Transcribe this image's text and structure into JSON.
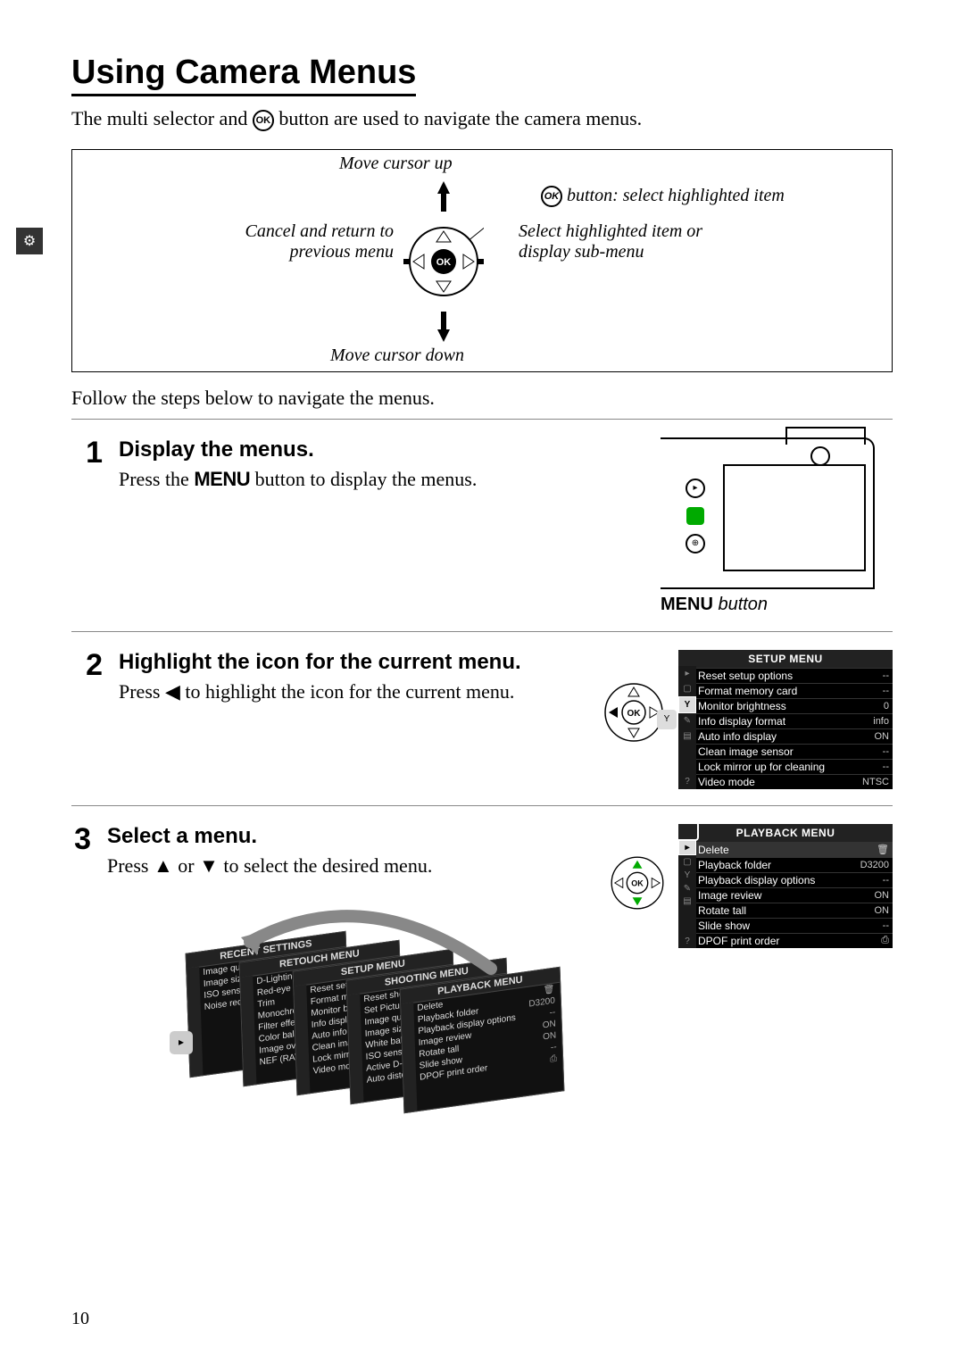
{
  "page_number": "10",
  "heading": "Using Camera Menus",
  "intro_pre": "The multi selector and ",
  "intro_post": " button are used to navigate the camera menus.",
  "ok_glyph": "OK",
  "selector": {
    "up": "Move cursor up",
    "down": "Move cursor down",
    "left": "Cancel and return to previous menu",
    "right": "Select highlighted item or display sub-menu",
    "ok": " button: select highlighted item"
  },
  "follow": "Follow the steps below to navigate the menus.",
  "steps": [
    {
      "num": "1",
      "title": "Display the menus.",
      "text_pre": "Press the ",
      "text_glyph": "MENU",
      "text_post": " button to display the menus.",
      "caption_glyph": "MENU",
      "caption_post": " button"
    },
    {
      "num": "2",
      "title": "Highlight the icon for the current menu.",
      "text_pre": "Press ",
      "text_glyph": "◀",
      "text_post": " to highlight the icon for the current menu."
    },
    {
      "num": "3",
      "title": "Select a menu.",
      "text_pre": "Press ",
      "text_glyph1": "▲",
      "text_mid": " or ",
      "text_glyph2": "▼",
      "text_post": " to select the desired menu."
    }
  ],
  "setup_menu": {
    "title": "SETUP MENU",
    "items": [
      {
        "label": "Reset setup options",
        "value": "--"
      },
      {
        "label": "Format memory card",
        "value": "--"
      },
      {
        "label": "Monitor brightness",
        "value": "0"
      },
      {
        "label": "Info display format",
        "value": "info"
      },
      {
        "label": "Auto info display",
        "value": "ON"
      },
      {
        "label": "Clean image sensor",
        "value": "--"
      },
      {
        "label": "Lock mirror up for cleaning",
        "value": "--"
      },
      {
        "label": "Video mode",
        "value": "NTSC"
      }
    ],
    "sidebar_icons": [
      "▸",
      "▢",
      "Y",
      "✎",
      "▤",
      "",
      "",
      "?"
    ]
  },
  "playback_menu": {
    "title": "PLAYBACK MENU",
    "items": [
      {
        "label": "Delete",
        "value": "🗑"
      },
      {
        "label": "Playback folder",
        "value": "D3200"
      },
      {
        "label": "Playback display options",
        "value": "--"
      },
      {
        "label": "Image review",
        "value": "ON"
      },
      {
        "label": "Rotate tall",
        "value": "ON"
      },
      {
        "label": "Slide show",
        "value": "--"
      },
      {
        "label": "DPOF print order",
        "value": "⎙"
      }
    ],
    "sidebar_icons": [
      "▸",
      "▢",
      "Y",
      "✎",
      "▤",
      "",
      "",
      "?"
    ]
  },
  "stack": [
    {
      "title": "RECENT SETTINGS",
      "rows": [
        "Image quality",
        "Image size",
        "ISO sensitivity",
        "Noise reduction"
      ]
    },
    {
      "title": "RETOUCH MENU",
      "rows": [
        "D-Lighting",
        "Red-eye correction",
        "Trim",
        "Monochrome",
        "Filter effects",
        "Color balance",
        "Image overlay",
        "NEF (RAW)"
      ]
    },
    {
      "title": "SETUP MENU",
      "rows": [
        "Reset setup options",
        "Format memory card",
        "Monitor brightness",
        "Info display format",
        "Auto info display",
        "Clean image sensor",
        "Lock mirror up",
        "Video mode"
      ]
    },
    {
      "title": "SHOOTING MENU",
      "rows": [
        "Reset shooting menu",
        "Set Picture Control",
        "Image quality",
        "Image size",
        "White balance",
        "ISO sensitivity",
        "Active D-Lighting",
        "Auto distortion"
      ]
    },
    {
      "title": "PLAYBACK MENU",
      "rows": [
        "Delete",
        "Playback folder",
        "Playback display options",
        "Image review",
        "Rotate tall",
        "Slide show",
        "DPOF print order"
      ]
    }
  ],
  "stack_values": [
    "🗑",
    "D3200",
    "--",
    "ON",
    "ON",
    "--",
    "⎙"
  ]
}
